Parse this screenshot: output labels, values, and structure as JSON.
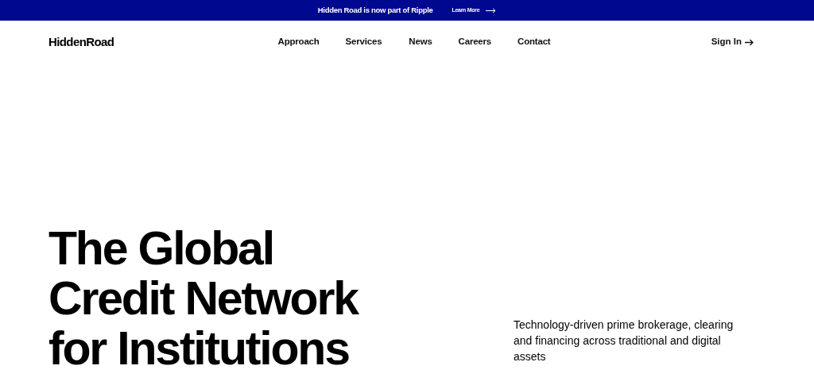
{
  "announcement": {
    "text": "Hidden Road is now part of Ripple",
    "link": "Learn More"
  },
  "header": {
    "logo": "HiddenRoad",
    "nav": [
      "Approach",
      "Services",
      "News",
      "Careers",
      "Contact"
    ],
    "sign_in": "Sign In"
  },
  "hero": {
    "headline": [
      "The Global",
      "Credit Network",
      "for Institutions"
    ],
    "subtitle": "Technology-driven prime brokerage, clearing and financing across traditional and digital assets"
  }
}
